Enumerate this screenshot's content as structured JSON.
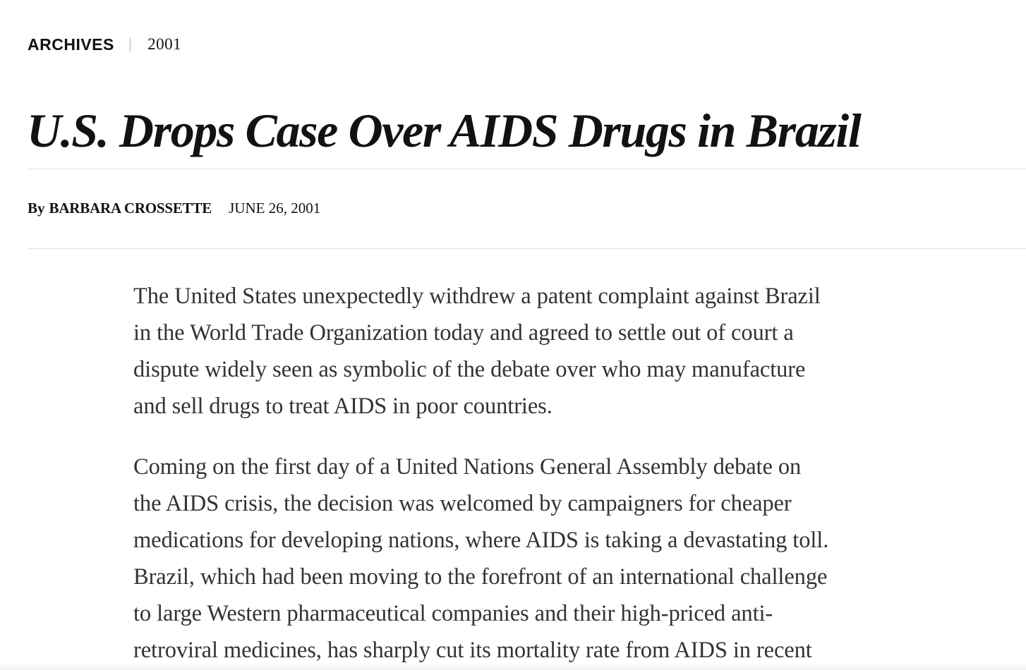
{
  "kicker": {
    "section": "ARCHIVES",
    "divider": "|",
    "year": "2001"
  },
  "article": {
    "headline": "U.S. Drops Case Over AIDS Drugs in Brazil",
    "byline": {
      "prefix": "By",
      "author": "BARBARA CROSSETTE",
      "date": "JUNE 26, 2001"
    },
    "paragraphs": [
      {
        "lines": [
          "The United States unexpectedly withdrew a patent complaint against Brazil",
          "in the World Trade Organization today and agreed to settle out of court a",
          "dispute widely seen as symbolic of the debate over who may manufacture",
          "and sell drugs to treat AIDS in poor countries."
        ]
      },
      {
        "lines": [
          "Coming on the first day of a United Nations General Assembly debate on",
          "the AIDS crisis, the decision was welcomed by campaigners for cheaper",
          "medications for developing nations, where AIDS is taking a devastating toll.",
          "Brazil, which had been moving to the forefront of an international challenge",
          "to large Western pharmaceutical companies and their high-priced anti-",
          "retroviral medicines, has sharply cut its mortality rate from AIDS in recent"
        ]
      }
    ]
  }
}
